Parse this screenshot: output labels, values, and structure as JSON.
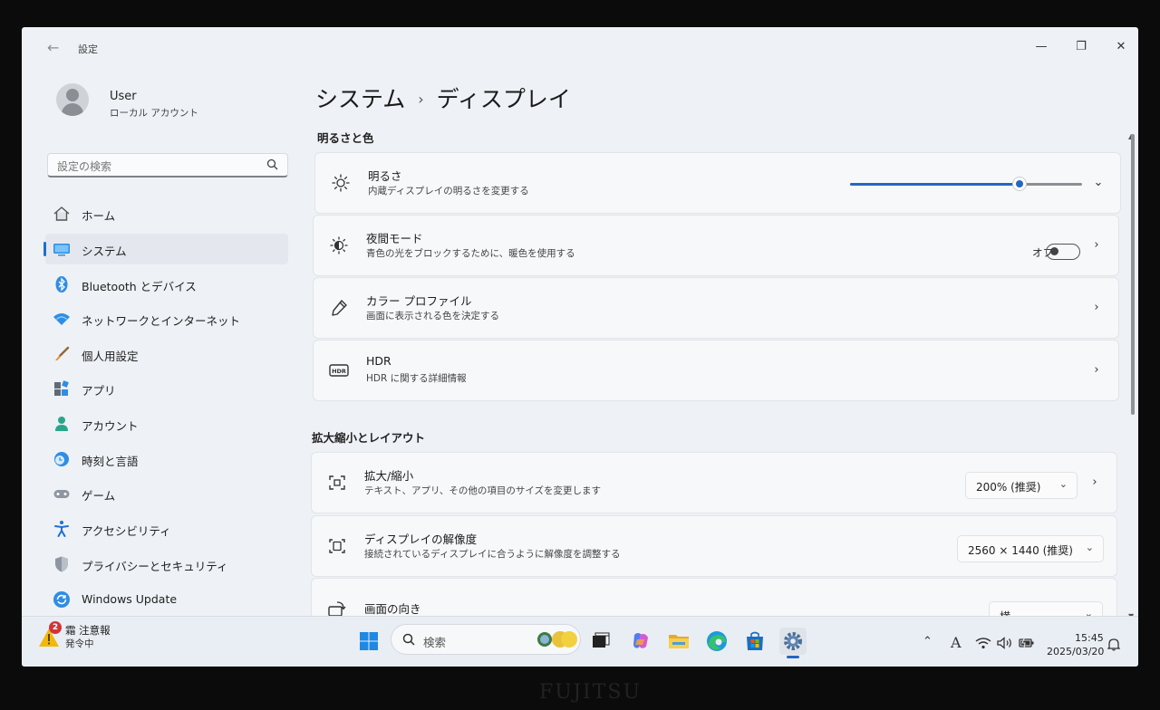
{
  "window": {
    "title": "設定",
    "back": "←",
    "minimize": "—",
    "restore": "❐",
    "close": "✕"
  },
  "user": {
    "name": "User",
    "account_type": "ローカル アカウント"
  },
  "search": {
    "placeholder": "設定の検索",
    "value": ""
  },
  "sidebar": {
    "items": [
      {
        "label": "ホーム",
        "icon": "home-icon",
        "active": false
      },
      {
        "label": "システム",
        "icon": "system-icon",
        "active": true
      },
      {
        "label": "Bluetooth とデバイス",
        "icon": "bluetooth-icon",
        "active": false
      },
      {
        "label": "ネットワークとインターネット",
        "icon": "wifi-icon",
        "active": false
      },
      {
        "label": "個人用設定",
        "icon": "brush-icon",
        "active": false
      },
      {
        "label": "アプリ",
        "icon": "apps-icon",
        "active": false
      },
      {
        "label": "アカウント",
        "icon": "account-icon",
        "active": false
      },
      {
        "label": "時刻と言語",
        "icon": "globe-clock-icon",
        "active": false
      },
      {
        "label": "ゲーム",
        "icon": "gamepad-icon",
        "active": false
      },
      {
        "label": "アクセシビリティ",
        "icon": "accessibility-icon",
        "active": false
      },
      {
        "label": "プライバシーとセキュリティ",
        "icon": "shield-icon",
        "active": false
      },
      {
        "label": "Windows Update",
        "icon": "update-icon",
        "active": false
      }
    ]
  },
  "header": {
    "parent": "システム",
    "separator": "›",
    "current": "ディスプレイ"
  },
  "sections": {
    "brightness_color": {
      "heading": "明るさと色",
      "brightness": {
        "title": "明るさ",
        "subtitle": "内蔵ディスプレイの明るさを変更する",
        "value": 73
      },
      "night_light": {
        "title": "夜間モード",
        "subtitle": "青色の光をブロックするために、暖色を使用する",
        "state_label": "オフ",
        "on": false
      },
      "color_profile": {
        "title": "カラー プロファイル",
        "subtitle": "画面に表示される色を決定する"
      },
      "hdr": {
        "title": "HDR",
        "subtitle": "HDR に関する詳細情報",
        "icon_text": "HDR"
      }
    },
    "scale_layout": {
      "heading": "拡大縮小とレイアウト",
      "scale": {
        "title": "拡大/縮小",
        "subtitle": "テキスト、アプリ、その他の項目のサイズを変更します",
        "value": "200% (推奨)"
      },
      "resolution": {
        "title": "ディスプレイの解像度",
        "subtitle": "接続されているディスプレイに合うように解像度を調整する",
        "value": "2560 × 1440 (推奨)"
      },
      "orientation": {
        "title": "画面の向き",
        "value": "横"
      }
    }
  },
  "taskbar": {
    "weather": {
      "title": "霜 注意報",
      "subtitle": "発令中",
      "badge": "2"
    },
    "search_placeholder": "検索",
    "tray_ime": "A",
    "clock": {
      "time": "15:45",
      "date": "2025/03/20"
    }
  },
  "bezel": {
    "brand": "FUJITSU"
  },
  "colors": {
    "accent": "#2466c4",
    "window_bg": "#eef1f5",
    "card_bg": "#f7f8fa",
    "badge": "#d13438"
  }
}
